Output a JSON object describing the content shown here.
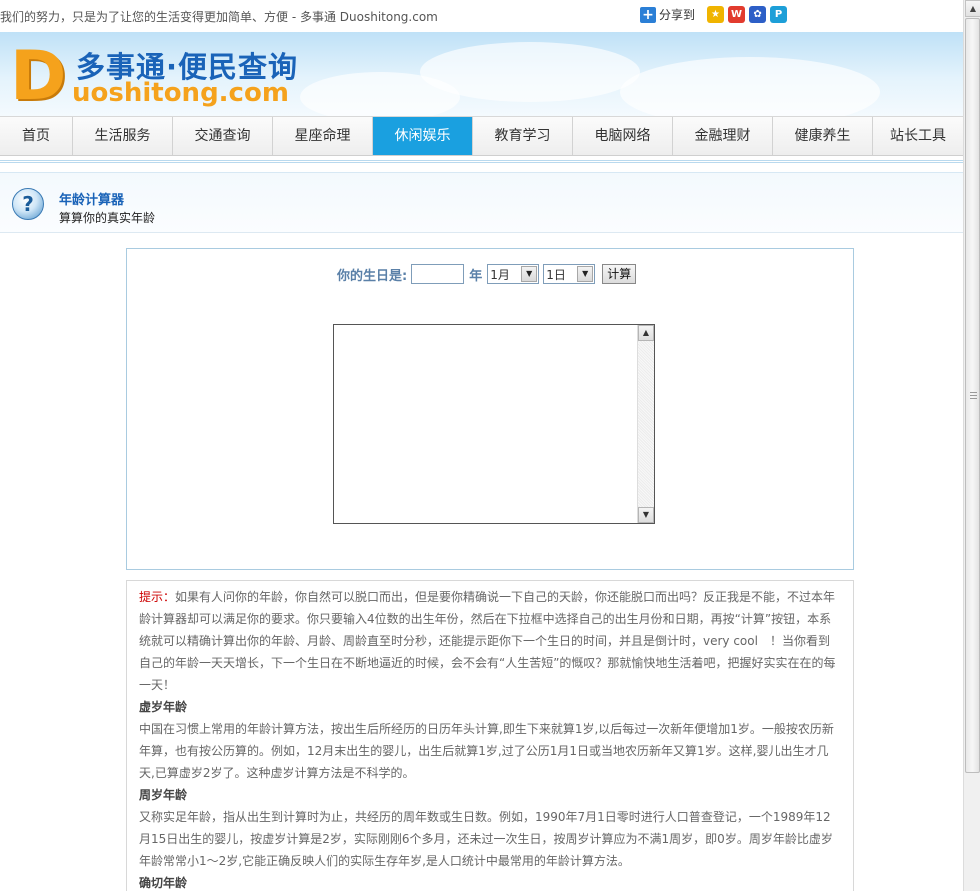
{
  "topbar": {
    "slogan": "我们的努力，只是为了让您的生活变得更加简单、方便 - 多事通 Duoshitong.com",
    "share_label": "分享到",
    "share_icons": [
      "qzone-icon",
      "weibo-icon",
      "baidu-icon",
      "pengyou-icon"
    ],
    "share_colors": [
      "#f0b400",
      "#e23b2e",
      "#2d5fc7",
      "#1d9fd8"
    ]
  },
  "logo": {
    "letter": "D",
    "cn_text": "多事通·便民查询",
    "en_text": "uoshitong.com"
  },
  "nav": {
    "items": [
      {
        "label": "首页"
      },
      {
        "label": "生活服务"
      },
      {
        "label": "交通查询"
      },
      {
        "label": "星座命理"
      },
      {
        "label": "休闲娱乐"
      },
      {
        "label": "教育学习"
      },
      {
        "label": "电脑网络"
      },
      {
        "label": "金融理财"
      },
      {
        "label": "健康养生"
      },
      {
        "label": "站长工具"
      }
    ],
    "active_index": 4,
    "active_color": "#1aa0e0"
  },
  "tool": {
    "icon": "question-icon",
    "title": "年龄计算器",
    "subtitle": "算算你的真实年龄"
  },
  "calculator": {
    "birthday_label": "你的生日是:",
    "year_value": "",
    "year_unit": "年",
    "month_selected": "1月",
    "day_selected": "1日",
    "calc_button": "计算",
    "result_text": ""
  },
  "info": {
    "tip_label": "提示：",
    "tip_text": "如果有人问你的年龄，你自然可以脱口而出，但是要你精确说一下自己的天龄，你还能脱口而出吗？反正我是不能，不过本年龄计算器却可以满足你的要求。你只要输入4位数的出生年份，然后在下拉框中选择自己的出生月份和日期，再按“计算”按钮，本系统就可以精确计算出你的年龄、月龄、周龄直至时分秒，还能提示距你下一个生日的时间，并且是倒计时，very cool　！当你看到自己的年龄一天天增长，下一个生日在不断地逼近的时候，会不会有“人生苦短”的慨叹？那就愉快地生活着吧，把握好实实在在的每一天！",
    "sections": [
      {
        "heading": "虚岁年龄",
        "text": "中国在习惯上常用的年龄计算方法，按出生后所经历的日历年头计算,即生下来就算1岁,以后每过一次新年便增加1岁。一般按农历新年算，也有按公历算的。例如，12月末出生的婴儿，出生后就算1岁,过了公历1月1日或当地农历新年又算1岁。这样,婴儿出生才几天,已算虚岁2岁了。这种虚岁计算方法是不科学的。"
      },
      {
        "heading": "周岁年龄",
        "text": "又称实足年龄，指从出生到计算时为止，共经历的周年数或生日数。例如，1990年7月1日零时进行人口普查登记，一个1989年12月15日出生的婴儿，按虚岁计算是2岁，实际刚刚6个多月，还未过一次生日，按周岁计算应为不满1周岁，即0岁。周岁年龄比虚岁年龄常常小1～2岁,它能正确反映人们的实际生存年岁,是人口统计中最常用的年龄计算方法。"
      },
      {
        "heading": "确切年龄",
        "text": ""
      }
    ]
  }
}
